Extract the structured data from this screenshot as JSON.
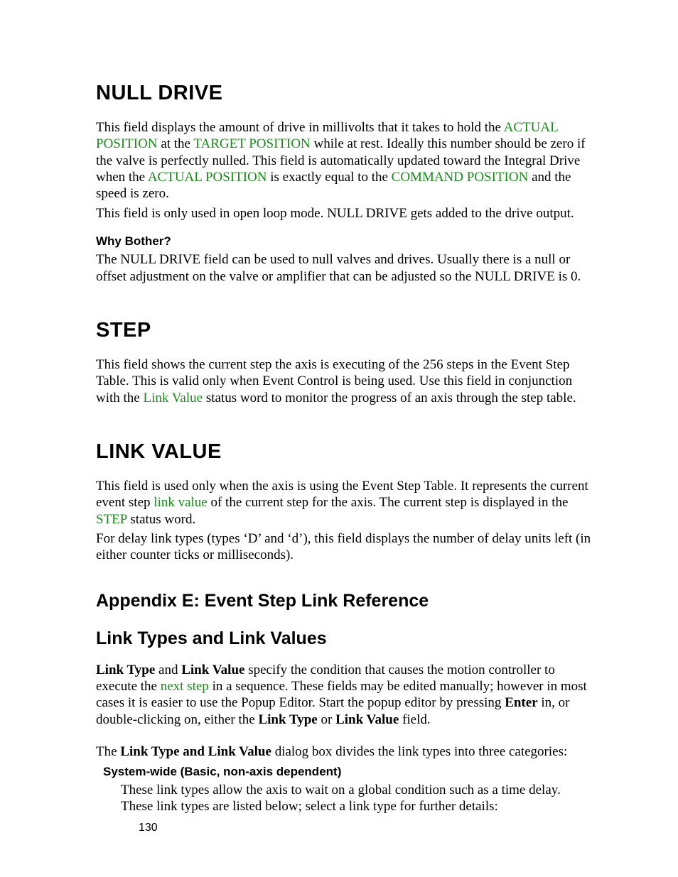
{
  "page_number": "130",
  "sections": {
    "null_drive": {
      "heading": "NULL DRIVE",
      "p1_a": "This field displays the amount of drive in millivolts that it takes to hold the ",
      "link1": "ACTUAL POSITION",
      "p1_b": " at the ",
      "link2": "TARGET POSITION",
      "p1_c": " while at rest.  Ideally this number should be zero if the valve is perfectly nulled.  This field is automatically updated toward the Integral Drive when the ",
      "link3": "ACTUAL POSITION",
      "p1_d": " is exactly equal to the ",
      "link4": "COMMAND POSITION",
      "p1_e": " and the speed is zero.",
      "p2": "This field is only used in open loop mode.  NULL DRIVE gets added to the drive output.",
      "sub_heading": "Why Bother?",
      "p3": "The NULL DRIVE field can be used to null valves and drives.  Usually there is a null or offset adjustment on the valve or amplifier that can be adjusted so the NULL DRIVE is 0."
    },
    "step": {
      "heading": "STEP",
      "p1_a": "This field shows the current step the axis is executing of the 256 steps in the Event Step Table.  This is valid only when Event Control is being used.  Use this field in conjunction with the ",
      "link1": "Link Value",
      "p1_b": " status word to monitor the progress of an axis through the step table."
    },
    "link_value": {
      "heading": "LINK VALUE",
      "p1_a": "This field is used only when the axis is using the Event Step Table.  It represents the current event step ",
      "link1": "link value",
      "p1_b": " of the current step for the axis.  The current step is displayed in the ",
      "link2": "STEP",
      "p1_c": " status word.",
      "p2": "For delay link types (types ‘D’ and ‘d’), this field displays the number of delay units left (in either counter ticks or milliseconds)."
    },
    "appendix": {
      "heading": "Appendix E: Event Step Link Reference",
      "sub_heading": "Link Types and Link Values",
      "p1_a_bold": "Link Type",
      "p1_b": " and ",
      "p1_c_bold": "Link Value",
      "p1_d": " specify the condition that causes the motion controller to execute the ",
      "link1": "next step",
      "p1_e": " in a sequence.  These fields may be edited manually; however in most cases it is easier to use the Popup Editor.  Start the popup editor by pressing ",
      "p1_f_bold": "Enter",
      "p1_g": " in, or double-clicking on, either the ",
      "p1_h_bold": "Link Type",
      "p1_i": " or ",
      "p1_j_bold": "Link Value",
      "p1_k": " field.",
      "p2_a": "The ",
      "p2_b_bold": "Link Type and Link Value",
      "p2_c": " dialog box divides the link types into three categories:",
      "cat_heading": "System-wide (Basic, non-axis dependent)",
      "cat_text": "These link types allow the axis to wait on a global condition such as a time delay. These link types are listed below; select a link type for further details:"
    }
  }
}
